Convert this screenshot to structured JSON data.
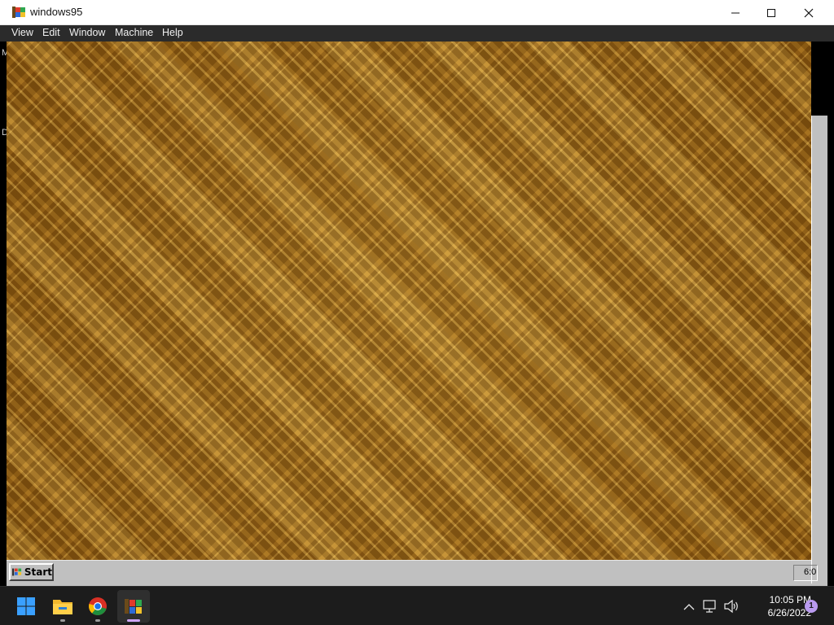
{
  "window": {
    "title": "windows95",
    "icon": "windows95-app-icon",
    "controls": [
      "minimize-icon",
      "maximize-icon",
      "close-icon"
    ]
  },
  "menu": {
    "items": [
      "View",
      "Edit",
      "Window",
      "Machine",
      "Help"
    ]
  },
  "vm": {
    "left_edge_fragments": [
      "M",
      "D"
    ],
    "desktop_wallpaper_color": "#a46a18",
    "taskbar": {
      "start_label": "Start",
      "clock_partial": "6:0"
    }
  },
  "host_taskbar": {
    "apps": [
      "windows-start-icon",
      "file-explorer-icon",
      "chrome-icon",
      "windows95-app-icon"
    ],
    "tray_icons": [
      "chevron-up-icon",
      "network-icon",
      "volume-icon"
    ],
    "clock": {
      "time": "10:05 PM",
      "date": "6/26/2022"
    },
    "notification_count": "1"
  },
  "colors": {
    "titlebar_bg": "#ffffff",
    "menubar_bg": "#2b2b2b",
    "w95_gray": "#c0c0c0",
    "host_taskbar_bg": "#1c1c1c",
    "accent_purple": "#b99aef"
  }
}
